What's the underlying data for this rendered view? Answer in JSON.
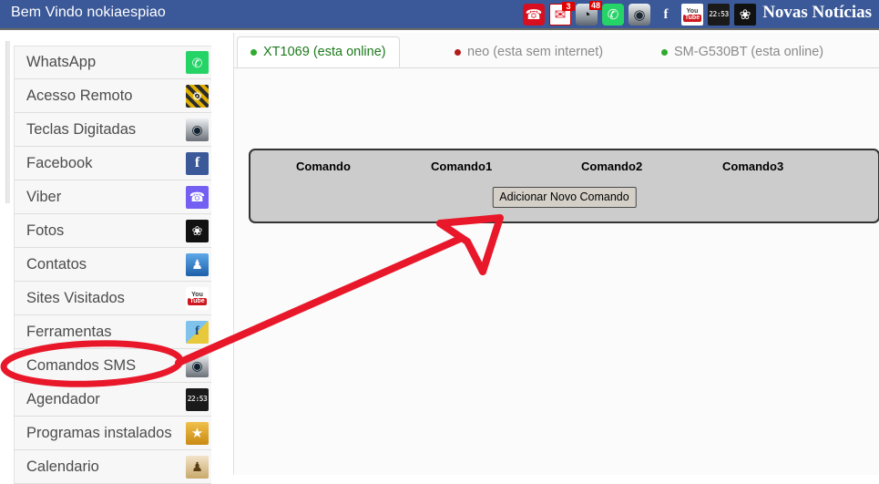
{
  "header": {
    "welcome_text": "Bem Vindo nokiaespiao",
    "news_label": "Novas Notícias",
    "background_color": "#3b5998",
    "icons": [
      {
        "name": "phone-icon",
        "glyph": "☎",
        "badge": ""
      },
      {
        "name": "mail-icon",
        "glyph": "✉",
        "badge": "3"
      },
      {
        "name": "speedometer-icon",
        "glyph": "◔",
        "badge": "48"
      },
      {
        "name": "whatsapp-icon",
        "glyph": "✆",
        "badge": ""
      },
      {
        "name": "camera-icon",
        "glyph": "◉",
        "badge": ""
      },
      {
        "name": "facebook-icon",
        "glyph": "f",
        "badge": ""
      },
      {
        "name": "youtube-icon",
        "glyph": "",
        "badge": ""
      },
      {
        "name": "clock-icon",
        "glyph": "22:53",
        "badge": ""
      },
      {
        "name": "playboy-icon",
        "glyph": "❀",
        "badge": ""
      }
    ],
    "youtube_top": "You",
    "youtube_bottom": "Tube"
  },
  "sidebar": {
    "items": [
      {
        "label": "WhatsApp",
        "icon": "whatsapp-icon",
        "icon_glyph": "✆",
        "icon_class": "si-whatsapp"
      },
      {
        "label": "Acesso Remoto",
        "icon": "gear-icon",
        "icon_glyph": "⚙",
        "icon_class": "si-gear"
      },
      {
        "label": "Teclas Digitadas",
        "icon": "camera-icon",
        "icon_glyph": "◉",
        "icon_class": "si-cam"
      },
      {
        "label": "Facebook",
        "icon": "facebook-icon",
        "icon_glyph": "f",
        "icon_class": "si-fb"
      },
      {
        "label": "Viber",
        "icon": "viber-icon",
        "icon_glyph": "☎",
        "icon_class": "si-viber"
      },
      {
        "label": "Fotos",
        "icon": "playboy-icon",
        "icon_glyph": "❀",
        "icon_class": "si-bunny"
      },
      {
        "label": "Contatos",
        "icon": "contact-icon",
        "icon_glyph": "♟",
        "icon_class": "si-contact"
      },
      {
        "label": "Sites Visitados",
        "icon": "youtube-icon",
        "icon_glyph": "",
        "icon_class": "si-yt"
      },
      {
        "label": "Ferramentas",
        "icon": "cube-icon",
        "icon_glyph": "f",
        "icon_class": "si-cube"
      },
      {
        "label": "Comandos SMS",
        "icon": "camera-icon",
        "icon_glyph": "◉",
        "icon_class": "si-cam"
      },
      {
        "label": "Agendador",
        "icon": "clock-icon",
        "icon_glyph": "22:53",
        "icon_class": "si-clock"
      },
      {
        "label": "Programas instalados",
        "icon": "star-icon",
        "icon_glyph": "★",
        "icon_class": "si-star"
      },
      {
        "label": "Calendario",
        "icon": "calendar-icon",
        "icon_glyph": "♟",
        "icon_class": "si-cal"
      }
    ]
  },
  "tabs": [
    {
      "label": "XT1069 (esta online)",
      "status": "online",
      "active": true
    },
    {
      "label": "neo (esta sem internet)",
      "status": "offline",
      "active": false
    },
    {
      "label": "SM-G530BT (esta online)",
      "status": "online",
      "active": false
    }
  ],
  "command_panel": {
    "columns": [
      "Comando",
      "Comando1",
      "Comando2",
      "Comando3"
    ],
    "add_button_label": "Adicionar Novo Comando",
    "background_color": "#cccccc",
    "border_color": "#333333"
  },
  "annotations": {
    "marker_color": "#e8182a",
    "ellipse_target": "Comandos SMS",
    "arrow_target": "Adicionar Novo Comando"
  }
}
